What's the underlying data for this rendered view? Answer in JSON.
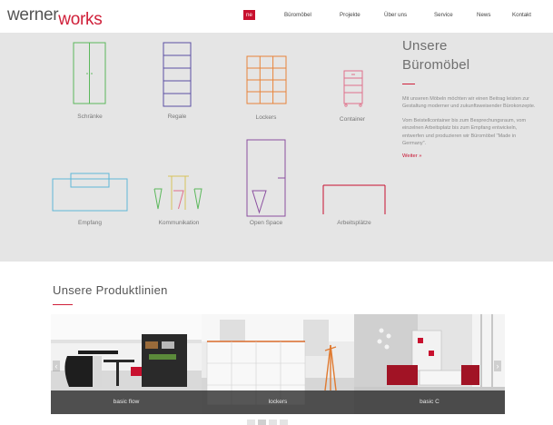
{
  "logo": {
    "part1": "werner",
    "part2": "works",
    "brand_red": "#d0203a"
  },
  "nav": {
    "items": [
      {
        "label": "ne",
        "active": true
      },
      {
        "label": "Büromöbel",
        "active": false
      },
      {
        "label": "Projekte",
        "active": false
      },
      {
        "label": "Über uns",
        "active": false
      },
      {
        "label": "Service",
        "active": false
      },
      {
        "label": "News",
        "active": false
      },
      {
        "label": "Kontakt",
        "active": false
      }
    ]
  },
  "furniture": {
    "items": [
      {
        "label": "Schränke",
        "icon": "cabinet-icon",
        "color": "#5cb85c"
      },
      {
        "label": "Regale",
        "icon": "shelf-icon",
        "color": "#5b4fa3"
      },
      {
        "label": "Lockers",
        "icon": "lockers-icon",
        "color": "#e8843a"
      },
      {
        "label": "Container",
        "icon": "container-icon",
        "color": "#e0708a"
      },
      {
        "label": "Empfang",
        "icon": "reception-icon",
        "color": "#5fb8d8"
      },
      {
        "label": "Kommunikation",
        "icon": "communication-icon",
        "color": "#d8c35a"
      },
      {
        "label": "Open Space",
        "icon": "open-space-icon",
        "color": "#8b4fa0"
      },
      {
        "label": "Arbeitsplätze",
        "icon": "workstation-icon",
        "color": "#c8102e"
      }
    ],
    "side": {
      "title_line1": "Unsere",
      "title_line2": "Büromöbel",
      "paragraph1": "Mit unseren Möbeln möchten wir einen Beitrag leisten zur Gestaltung moderner und zukunftsweisender Bürokonzepte.",
      "paragraph2": "Vom Beistellcontainer bis zum Besprechungsraum, vom einzelnen Arbeitsplatz bis zum Empfang entwickeln, entwerfen und produzieren wir Büromöbel \"Made in Germany\".",
      "more_link": "Weiter »"
    }
  },
  "product_lines": {
    "title": "Unsere Produktlinien",
    "cards": [
      {
        "caption": "basic flow"
      },
      {
        "caption": "lockers"
      },
      {
        "caption": "basic C"
      }
    ],
    "slides_count": 4,
    "active_slide": 1
  }
}
